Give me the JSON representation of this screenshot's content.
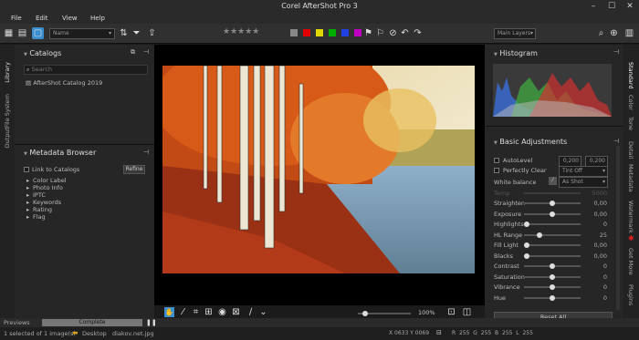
{
  "app": {
    "title": "Corel AfterShot Pro 3"
  },
  "menu": [
    "File",
    "Edit",
    "View",
    "Help"
  ],
  "toolbar": {
    "sort_combo": "Name",
    "layers_combo": "Main Layers",
    "rating_stars": "★★★★★",
    "color_labels": [
      "#888888",
      "#e00000",
      "#e0d800",
      "#00b000",
      "#2040e0",
      "#c000c0"
    ]
  },
  "library": {
    "catalogs_title": "Catalogs",
    "search_placeholder": "Search",
    "catalog_item": "AfterShot Catalog 2019",
    "metadata_title": "Metadata Browser",
    "link_label": "Link to Catalogs",
    "refine_label": "Refine",
    "tree": [
      "Color Label",
      "Photo Info",
      "IPTC",
      "Keywords",
      "Rating",
      "Flag"
    ]
  },
  "left_tabs": [
    "Library",
    "File System",
    "Output"
  ],
  "right_tabs": [
    "Standard",
    "Color",
    "Tone",
    "Detail",
    "Metadata",
    "Watermark",
    "Get More",
    "Plugins"
  ],
  "histogram": {
    "title": "Histogram"
  },
  "basic": {
    "title": "Basic Adjustments",
    "autolevel": "AutoLevel",
    "autolevel_vals": [
      "0,200",
      "0,200"
    ],
    "perfectly_clear": "Perfectly Clear",
    "tint_off": "Tint Off",
    "white_balance": "White balance",
    "as_shot": "As Shot",
    "temp_label": "Temp",
    "temp_val": "5000",
    "sliders": [
      {
        "label": "Straighten",
        "value": "0,00",
        "level": 0.5
      },
      {
        "label": "Exposure",
        "value": "0,00",
        "level": 0.5
      },
      {
        "label": "Highlights",
        "value": "0",
        "level": 0.0
      },
      {
        "label": "HL Range",
        "value": "25",
        "level": 0.25
      },
      {
        "label": "Fill Light",
        "value": "0,00",
        "level": 0.0
      },
      {
        "label": "Blacks",
        "value": "0,00",
        "level": 0.0
      },
      {
        "label": "Contrast",
        "value": "0",
        "level": 0.5
      },
      {
        "label": "Saturation",
        "value": "0",
        "level": 0.5
      },
      {
        "label": "Vibrance",
        "value": "0",
        "level": 0.5
      },
      {
        "label": "Hue",
        "value": "0",
        "level": 0.5
      }
    ],
    "reset_all": "Reset All"
  },
  "viewer": {
    "zoom": "100%"
  },
  "filmstrip": {
    "previews": "Previews",
    "complete": "Complete"
  },
  "status": {
    "selection": "1 selected of 1 image(s)",
    "folder": "Desktop",
    "filename": "diakov.net.jpg",
    "coords": "X 0633  Y 0069",
    "r_label": "R",
    "r": "255",
    "g_label": "G",
    "g": "255",
    "b_label": "B",
    "b": "255",
    "l_label": "L",
    "l": "255"
  }
}
